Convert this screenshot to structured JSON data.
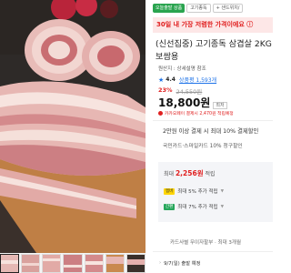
{
  "gallery": {
    "image_alt": "pork belly product photo",
    "thumbnail_count": 7
  },
  "badges": [
    {
      "label": "오늘출발 상품",
      "style": "green"
    },
    {
      "label": "고기종독",
      "style": "outline"
    },
    {
      "label": "+ 샌드위치/",
      "style": "outline"
    }
  ],
  "promo": "30일 내 가장 저렴한 가격이에요 ⓘ",
  "product": {
    "title_line1": "(신선집중) 고기종독 삼겹살 2KG",
    "title_line2": "보쌈용",
    "origin": "원산지 : 상세설명 참조",
    "rating": "4.4",
    "review": "상품평 1,593개",
    "discount_pct": "23%",
    "original_price": "24,550원",
    "price": "18,800원",
    "price_tag": "최저",
    "coupon_text": "카카오페이 결제시 2,470원 적립예정"
  },
  "card_benefit": {
    "line1": "2만원 이상 결제 시 최대 10% 결제할인",
    "line2": "국민카드·스마일카드 10% 청구할인"
  },
  "points": {
    "label_prefix": "최대",
    "amount": "2,256원",
    "label_suffix": "적립",
    "rows": [
      {
        "chip": "멤버",
        "text": "최대 5% 추가 적립"
      },
      {
        "chip": "간편",
        "text": "최대 7% 추가 적립"
      }
    ]
  },
  "installment": "카드사별 무이자할부 · 최대 3개월",
  "shipping": "9/7(일) 출발 예정"
}
